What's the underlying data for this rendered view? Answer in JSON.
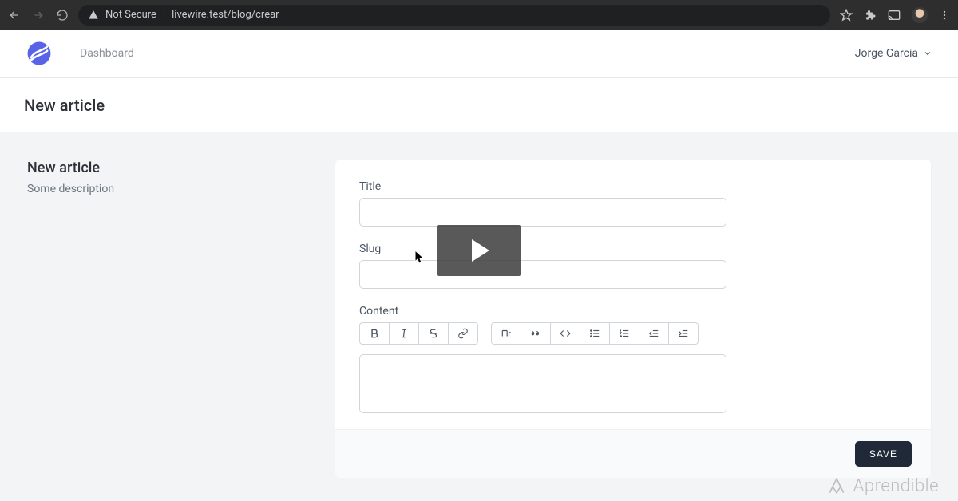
{
  "browser": {
    "security_label": "Not Secure",
    "url": "livewire.test/blog/crear"
  },
  "header": {
    "nav_dashboard": "Dashboard",
    "user_name": "Jorge Garcia"
  },
  "page": {
    "title": "New article"
  },
  "side": {
    "heading": "New article",
    "description": "Some description"
  },
  "form": {
    "title_label": "Title",
    "title_value": "",
    "slug_label": "Slug",
    "slug_value": "",
    "content_label": "Content",
    "content_value": "",
    "save_label": "SAVE"
  },
  "watermark": {
    "text": "Aprendible"
  }
}
